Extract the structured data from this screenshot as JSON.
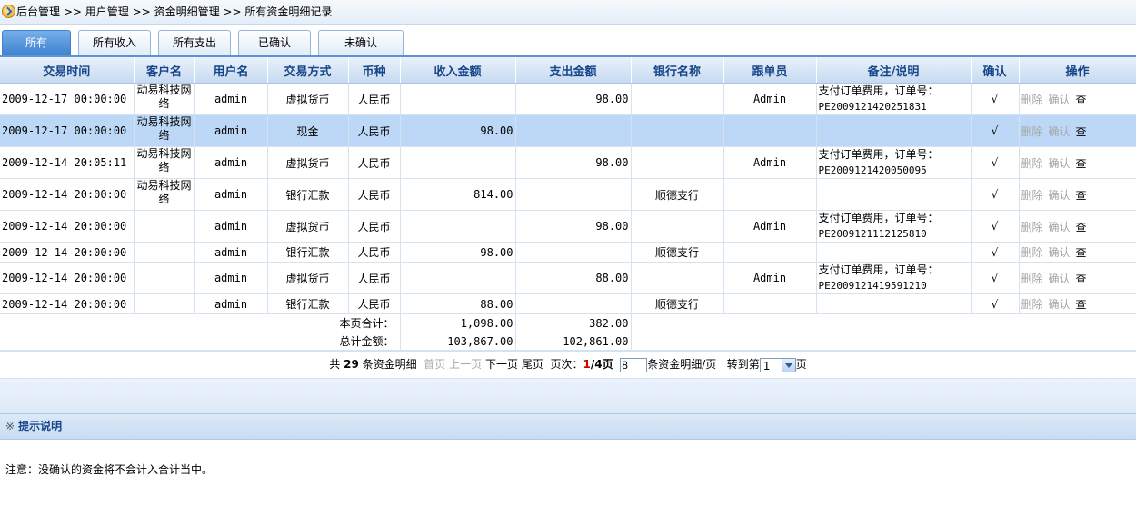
{
  "breadcrumb": [
    "后台管理",
    ">>",
    "用户管理",
    ">>",
    "资金明细管理",
    ">>",
    "所有资金明细记录"
  ],
  "tabs": [
    "所有",
    "所有收入",
    "所有支出",
    "已确认",
    "未确认"
  ],
  "columns": [
    "交易时间",
    "客户名",
    "用户名",
    "交易方式",
    "币种",
    "收入金额",
    "支出金额",
    "银行名称",
    "跟单员",
    "备注/说明",
    "确认",
    "操作"
  ],
  "rows": [
    {
      "time": "2009-12-17 00:00:00",
      "customer": "动易科技网络",
      "user": "admin",
      "method": "虚拟货币",
      "currency": "人民币",
      "income": "",
      "expense": "98.00",
      "bank": "",
      "handler": "Admin",
      "note1": "支付订单费用，订单号：",
      "note2": "PE2009121420251831",
      "confirm": "√"
    },
    {
      "time": "2009-12-17 00:00:00",
      "customer": "动易科技网络",
      "user": "admin",
      "method": "现金",
      "currency": "人民币",
      "income": "98.00",
      "expense": "",
      "bank": "",
      "handler": "",
      "note1": "",
      "note2": "",
      "confirm": "√"
    },
    {
      "time": "2009-12-14 20:05:11",
      "customer": "动易科技网络",
      "user": "admin",
      "method": "虚拟货币",
      "currency": "人民币",
      "income": "",
      "expense": "98.00",
      "bank": "",
      "handler": "Admin",
      "note1": "支付订单费用，订单号：",
      "note2": "PE2009121420050095",
      "confirm": "√"
    },
    {
      "time": "2009-12-14 20:00:00",
      "customer": "动易科技网络",
      "user": "admin",
      "method": "银行汇款",
      "currency": "人民币",
      "income": "814.00",
      "expense": "",
      "bank": "顺德支行",
      "handler": "",
      "note1": "",
      "note2": "",
      "confirm": "√"
    },
    {
      "time": "2009-12-14 20:00:00",
      "customer": "",
      "user": "admin",
      "method": "虚拟货币",
      "currency": "人民币",
      "income": "",
      "expense": "98.00",
      "bank": "",
      "handler": "Admin",
      "note1": "支付订单费用，订单号：",
      "note2": "PE2009121112125810",
      "confirm": "√"
    },
    {
      "time": "2009-12-14 20:00:00",
      "customer": "",
      "user": "admin",
      "method": "银行汇款",
      "currency": "人民币",
      "income": "98.00",
      "expense": "",
      "bank": "顺德支行",
      "handler": "",
      "note1": "",
      "note2": "",
      "confirm": "√"
    },
    {
      "time": "2009-12-14 20:00:00",
      "customer": "",
      "user": "admin",
      "method": "虚拟货币",
      "currency": "人民币",
      "income": "",
      "expense": "88.00",
      "bank": "",
      "handler": "Admin",
      "note1": "支付订单费用，订单号：",
      "note2": "PE2009121419591210",
      "confirm": "√"
    },
    {
      "time": "2009-12-14 20:00:00",
      "customer": "",
      "user": "admin",
      "method": "银行汇款",
      "currency": "人民币",
      "income": "88.00",
      "expense": "",
      "bank": "顺德支行",
      "handler": "",
      "note1": "",
      "note2": "",
      "confirm": "√"
    }
  ],
  "ops": {
    "delete": "删除",
    "confirm": "确认",
    "view": "查"
  },
  "summary": {
    "page_label": "本页合计：",
    "page_income": "1,098.00",
    "page_expense": "382.00",
    "total_label": "总计金额：",
    "total_income": "103,867.00",
    "total_expense": "102,861.00"
  },
  "pager": {
    "prefix": "共",
    "total": "29",
    "unit": "条资金明细",
    "first": "首页",
    "prev": "上一页",
    "next": "下一页",
    "last": "尾页",
    "page_label": "页次：",
    "current": "1",
    "total_pages": "/4页",
    "per_page": "8",
    "per_page_suffix": "条资金明细/页",
    "goto_label": "转到第",
    "goto_value": "1",
    "goto_suffix": "页"
  },
  "tips": {
    "title": "提示说明",
    "icon": "※",
    "body": "注意：没确认的资金将不会计入合计当中。"
  }
}
